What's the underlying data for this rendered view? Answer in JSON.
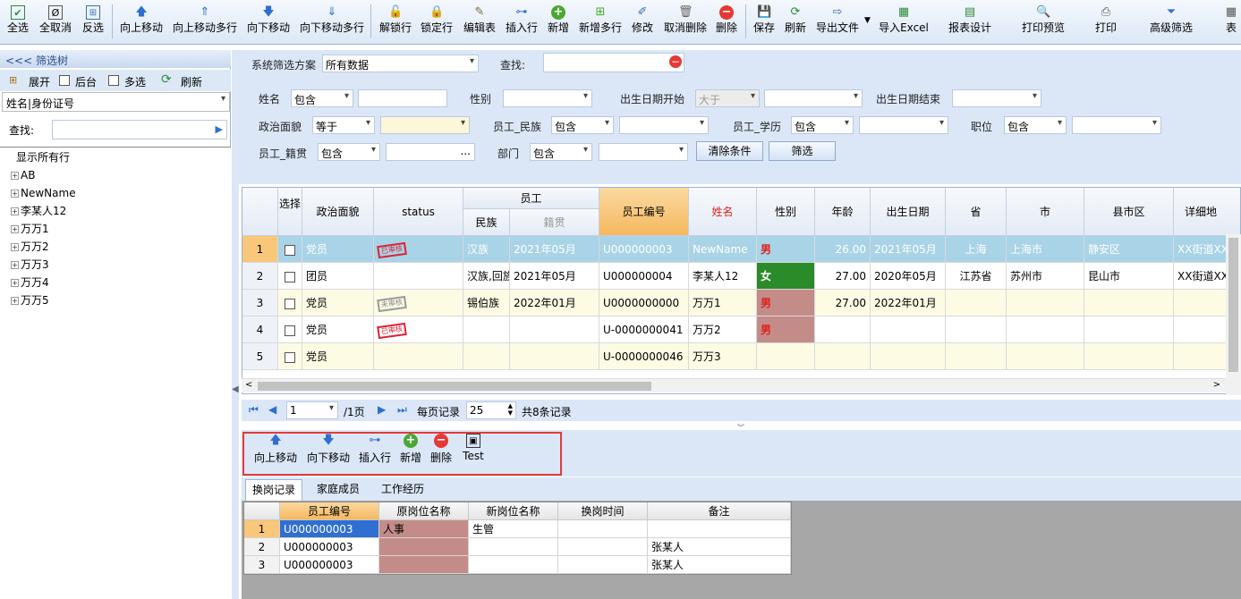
{
  "toolbar": {
    "items": [
      {
        "label": "全选",
        "icon": "check-icon"
      },
      {
        "label": "全取消",
        "icon": "cancel-icon"
      },
      {
        "label": "反选",
        "icon": "invert-icon"
      },
      {
        "label": "向上移动",
        "icon": "arrow-up-icon"
      },
      {
        "label": "向上移动多行",
        "icon": "arrow-up-multi-icon"
      },
      {
        "label": "向下移动",
        "icon": "arrow-down-icon"
      },
      {
        "label": "向下移动多行",
        "icon": "arrow-down-multi-icon"
      },
      {
        "label": "解锁行",
        "icon": "unlock-icon"
      },
      {
        "label": "锁定行",
        "icon": "lock-icon"
      },
      {
        "label": "编辑表",
        "icon": "edit-table-icon"
      },
      {
        "label": "插入行",
        "icon": "insert-row-icon"
      },
      {
        "label": "新增",
        "icon": "add-icon"
      },
      {
        "label": "新增多行",
        "icon": "add-multi-icon"
      },
      {
        "label": "修改",
        "icon": "modify-icon"
      },
      {
        "label": "取消删除",
        "icon": "undo-delete-icon"
      },
      {
        "label": "删除",
        "icon": "delete-icon"
      },
      {
        "label": "保存",
        "icon": "save-icon"
      },
      {
        "label": "刷新",
        "icon": "refresh-icon"
      },
      {
        "label": "导出文件",
        "icon": "export-icon"
      },
      {
        "label": "导入Excel",
        "icon": "excel-icon"
      },
      {
        "label": "报表设计",
        "icon": "report-icon"
      },
      {
        "label": "打印预览",
        "icon": "print-preview-icon"
      },
      {
        "label": "打印",
        "icon": "print-icon"
      },
      {
        "label": "高级筛选",
        "icon": "filter-icon"
      },
      {
        "label": "表",
        "icon": "table-icon"
      }
    ]
  },
  "left": {
    "header": "<<< 筛选树",
    "expand_label": "展开",
    "background_label": "后台",
    "multi_label": "多选",
    "refresh_label": "刷新",
    "combo_value": "姓名|身份证号",
    "search_label": "查找:",
    "tree": [
      "显示所有行",
      "AB",
      "NewName",
      "李某人12",
      "万万1",
      "万万2",
      "万万3",
      "万万4",
      "万万5"
    ]
  },
  "filter": {
    "scheme_label": "系统筛选方案",
    "scheme_value": "所有数据",
    "search_label": "查找:",
    "name_label": "姓名",
    "name_op": "包含",
    "gender_label": "性别",
    "birth_start_label": "出生日期开始",
    "birth_start_op": "大于",
    "birth_end_label": "出生日期结束",
    "political_label": "政治面貌",
    "political_op": "等于",
    "ethnic_label": "员工_民族",
    "ethnic_op": "包含",
    "edu_label": "员工_学历",
    "edu_op": "包含",
    "position_label": "职位",
    "position_op": "包含",
    "native_label": "员工_籍贯",
    "native_op": "包含",
    "native_ellipsis": "...",
    "dept_label": "部门",
    "dept_op": "包含",
    "clear_label": "清除条件",
    "filter_label": "筛选"
  },
  "grid": {
    "headers": {
      "select": "选择",
      "political": "政治面貌",
      "status": "status",
      "employee_group": "员工",
      "ethnic": "民族",
      "native": "籍贯",
      "emp_no": "员工编号",
      "name": "姓名",
      "gender": "性别",
      "age": "年龄",
      "birth": "出生日期",
      "province": "省",
      "city": "市",
      "county": "县市区",
      "address": "详细地"
    },
    "rows": [
      {
        "no": "1",
        "political": "党员",
        "status": "已审核",
        "ethnic": "汉族",
        "native": "2021年05月",
        "emp_no": "U000000003",
        "name": "NewName",
        "gender": "男",
        "age": "26.00",
        "birth": "2021年05月",
        "province": "上海",
        "city": "上海市",
        "county": "静安区",
        "address": "XX街道XX"
      },
      {
        "no": "2",
        "political": "团员",
        "status": "",
        "ethnic": "汉族,回族",
        "native": "2021年05月",
        "emp_no": "U000000004",
        "name": "李某人12",
        "gender": "女",
        "age": "27.00",
        "birth": "2020年05月",
        "province": "江苏省",
        "city": "苏州市",
        "county": "昆山市",
        "address": "XX街道XX"
      },
      {
        "no": "3",
        "political": "党员",
        "status": "未审核",
        "ethnic": "锡伯族",
        "native": "2022年01月",
        "emp_no": "U0000000000",
        "name": "万万1",
        "gender": "男",
        "age": "27.00",
        "birth": "2022年01月",
        "province": "",
        "city": "",
        "county": "",
        "address": ""
      },
      {
        "no": "4",
        "political": "党员",
        "status": "已审核",
        "ethnic": "",
        "native": "",
        "emp_no": "U-0000000041",
        "name": "万万2",
        "gender": "男",
        "age": "",
        "birth": "",
        "province": "",
        "city": "",
        "county": "",
        "address": ""
      },
      {
        "no": "5",
        "political": "党员",
        "status": "",
        "ethnic": "",
        "native": "",
        "emp_no": "U-0000000046",
        "name": "万万3",
        "gender": "",
        "age": "",
        "birth": "",
        "province": "",
        "city": "",
        "county": "",
        "address": ""
      }
    ]
  },
  "pager": {
    "page": "1",
    "total_pages": "/1页",
    "per_page_label": "每页记录",
    "per_page": "25",
    "total": "共8条记录"
  },
  "bottom_toolbar": {
    "items": [
      {
        "label": "向上移动",
        "icon": "arrow-up-icon"
      },
      {
        "label": "向下移动",
        "icon": "arrow-down-icon"
      },
      {
        "label": "插入行",
        "icon": "insert-row-icon"
      },
      {
        "label": "新增",
        "icon": "add-icon"
      },
      {
        "label": "删除",
        "icon": "delete-icon"
      },
      {
        "label": "Test",
        "icon": "test-icon"
      }
    ]
  },
  "tabs": [
    "换岗记录",
    "家庭成员",
    "工作经历"
  ],
  "subgrid": {
    "headers": [
      "员工编号",
      "原岗位名称",
      "新岗位名称",
      "换岗时间",
      "备注"
    ],
    "rows": [
      {
        "no": "1",
        "emp_no": "U000000003",
        "old": "人事",
        "new": "生管",
        "time": "",
        "note": ""
      },
      {
        "no": "2",
        "emp_no": "U000000003",
        "old": "",
        "new": "",
        "time": "",
        "note": "张某人"
      },
      {
        "no": "3",
        "emp_no": "U000000003",
        "old": "",
        "new": "",
        "time": "",
        "note": "张某人"
      }
    ]
  },
  "colors": {
    "accent_blue": "#2f6fd1",
    "selected_row": "#a9d3e6",
    "row_yellow": "#fdfbe4",
    "header_orange": "#f8c77a",
    "female_green": "#2a8b2a",
    "male_rose": "#c48c88",
    "red_box": "#e23b3b"
  }
}
